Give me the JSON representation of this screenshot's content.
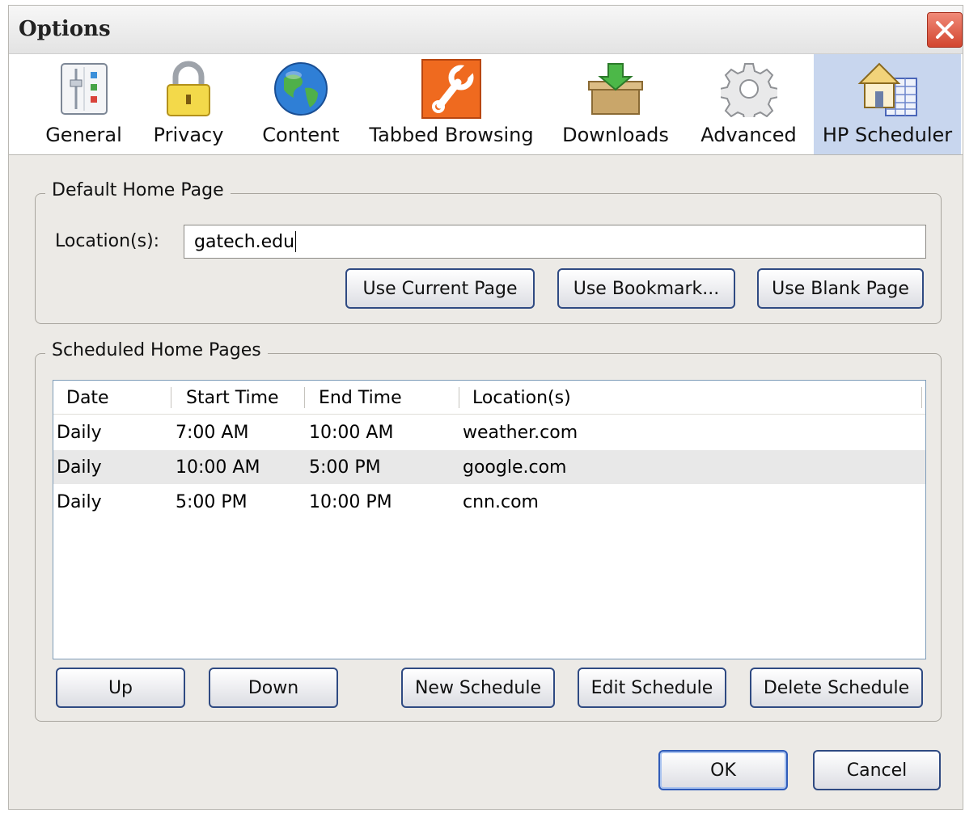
{
  "window": {
    "title": "Options"
  },
  "tabs": [
    {
      "label": "General",
      "icon": "general-settings-icon"
    },
    {
      "label": "Privacy",
      "icon": "padlock-icon"
    },
    {
      "label": "Content",
      "icon": "globe-icon"
    },
    {
      "label": "Tabbed Browsing",
      "icon": "wrench-icon"
    },
    {
      "label": "Downloads",
      "icon": "download-box-icon"
    },
    {
      "label": "Advanced",
      "icon": "gear-icon"
    },
    {
      "label": "HP Scheduler",
      "icon": "home-schedule-icon",
      "selected": true
    }
  ],
  "default_home": {
    "legend": "Default Home Page",
    "location_label": "Location(s):",
    "location_value": "gatech.edu",
    "buttons": {
      "use_current": "Use Current Page",
      "use_bookmark": "Use Bookmark...",
      "use_blank": "Use Blank Page"
    }
  },
  "scheduled": {
    "legend": "Scheduled Home Pages",
    "columns": [
      "Date",
      "Start Time",
      "End Time",
      "Location(s)"
    ],
    "rows": [
      {
        "date": "Daily",
        "start": "7:00 AM",
        "end": "10:00 AM",
        "location": "weather.com"
      },
      {
        "date": "Daily",
        "start": "10:00 AM",
        "end": "5:00 PM",
        "location": "google.com"
      },
      {
        "date": "Daily",
        "start": "5:00 PM",
        "end": "10:00 PM",
        "location": "cnn.com"
      }
    ],
    "buttons": {
      "up": "Up",
      "down": "Down",
      "new": "New Schedule",
      "edit": "Edit Schedule",
      "delete": "Delete Schedule"
    }
  },
  "footer": {
    "ok": "OK",
    "cancel": "Cancel"
  },
  "colors": {
    "selected_tab": "#c8d6ee",
    "close_button": "#d2452f",
    "button_border": "#2f4a82"
  }
}
